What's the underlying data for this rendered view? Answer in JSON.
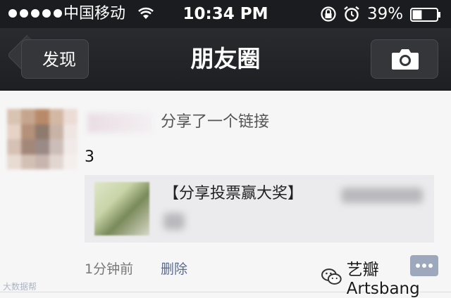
{
  "status_bar": {
    "carrier": "中国移动",
    "time": "10:34 PM",
    "battery_percent": "39%",
    "battery_level": 0.39,
    "icons": [
      "signal-dots",
      "wifi-icon",
      "rotation-lock-icon",
      "alarm-icon",
      "battery-icon"
    ]
  },
  "nav": {
    "back_label": "发现",
    "title": "朋友圈",
    "right_icon": "camera-icon"
  },
  "post": {
    "action": "分享了一个链接",
    "text": "3",
    "link_title": "【分享投票赢大奖】",
    "timestamp": "1分钟前",
    "delete_label": "删除",
    "comment_icon": "comment-more-icon"
  },
  "watermarks": {
    "left": "大数据帮",
    "right": "艺瓣Artsbang"
  },
  "colors": {
    "bar_background": "#1b1c1f",
    "link_blue": "#576b95",
    "feed_background": "#f6f6f6"
  }
}
